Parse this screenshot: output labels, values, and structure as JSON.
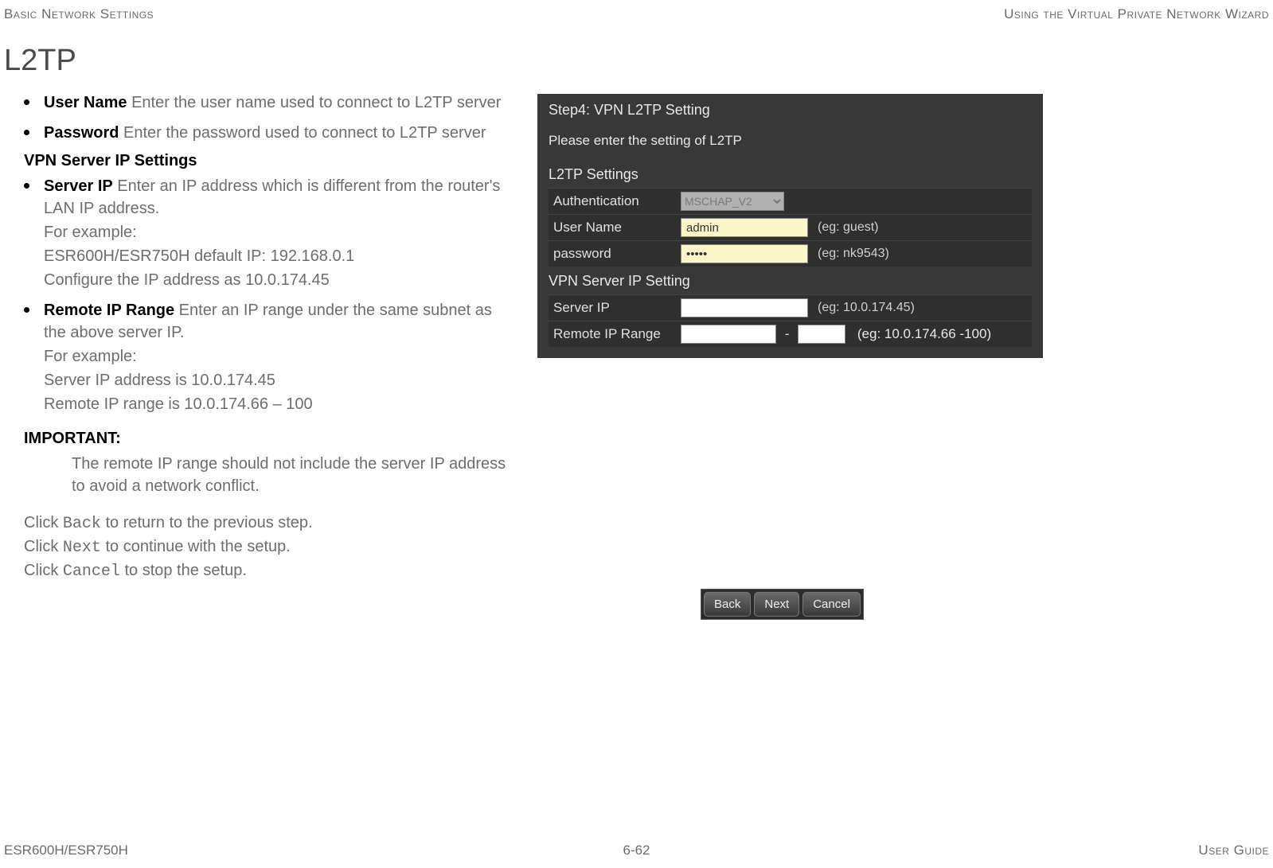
{
  "header": {
    "left": "Basic Network Settings",
    "right": "Using the Virtual Private Network Wizard"
  },
  "section_title": "L2TP",
  "bullets": {
    "username_term": "User Name",
    "username_desc": "  Enter the user name used to connect to L2TP server",
    "password_term": "Password",
    "password_desc": "  Enter the password used to connect to L2TP server",
    "vpn_subheading": "VPN Server IP Settings",
    "serverip_term": "Server IP",
    "serverip_desc": "  Enter an IP address which is different from the router's LAN IP address.",
    "serverip_ex1": "For example:",
    "serverip_ex2": "ESR600H/ESR750H default IP: 192.168.0.1",
    "serverip_ex3": "Configure the IP address as 10.0.174.45",
    "range_term": "Remote IP Range",
    "range_desc": "  Enter an IP range under the same subnet as the above server IP.",
    "range_ex1": "For example:",
    "range_ex2": "Server IP address is 10.0.174.45",
    "range_ex3": "Remote IP range is 10.0.174.66 – 100"
  },
  "important": {
    "label": "IMPORTANT:",
    "text": "The remote IP range should not include the server IP address to avoid a network conflict."
  },
  "click": {
    "pre1": "Click ",
    "back": "Back",
    "post1": " to return to the previous step.",
    "pre2": "Click ",
    "next": "Next",
    "post2": " to continue with the setup.",
    "pre3": "Click ",
    "cancel": "Cancel",
    "post3": " to stop the setup."
  },
  "shot": {
    "step_title": "Step4: VPN L2TP Setting",
    "step_sub": "Please enter the setting of L2TP",
    "group1": "L2TP Settings",
    "auth_label": "Authentication",
    "auth_value": "MSCHAP_V2",
    "user_label": "User Name",
    "user_value": "admin",
    "user_hint": "(eg: guest)",
    "pass_label": "password",
    "pass_value": "•••••",
    "pass_hint": "(eg: nk9543)",
    "group2": "VPN Server IP Setting",
    "serverip_label": "Server IP",
    "serverip_value": "",
    "serverip_hint": "(eg: 10.0.174.45)",
    "range_label": "Remote IP Range",
    "range_start": "",
    "range_dash": "-",
    "range_end": "",
    "range_hint": "(eg: 10.0.174.66 -100)"
  },
  "nav": {
    "back": "Back",
    "next": "Next",
    "cancel": "Cancel"
  },
  "footer": {
    "left": "ESR600H/ESR750H",
    "center": "6-62",
    "right": "User Guide"
  }
}
